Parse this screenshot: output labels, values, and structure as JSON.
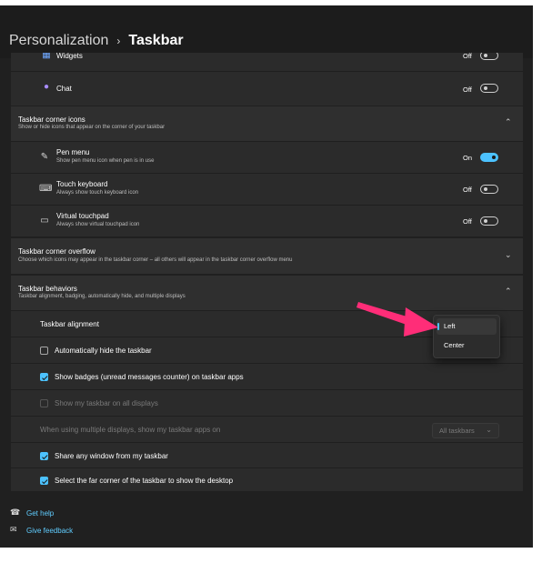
{
  "breadcrumb": {
    "parent": "Personalization",
    "separator": "›",
    "current": "Taskbar"
  },
  "top_items": [
    {
      "label": "Widgets",
      "state": "Off",
      "icon": "widgets-icon"
    },
    {
      "label": "Chat",
      "state": "Off",
      "icon": "chat-icon"
    }
  ],
  "corner_icons": {
    "title": "Taskbar corner icons",
    "subtitle": "Show or hide icons that appear on the corner of your taskbar",
    "items": [
      {
        "label": "Pen menu",
        "desc": "Show pen menu icon when pen is in use",
        "state": "On",
        "icon": "pen-icon"
      },
      {
        "label": "Touch keyboard",
        "desc": "Always show touch keyboard icon",
        "state": "Off",
        "icon": "keyboard-icon"
      },
      {
        "label": "Virtual touchpad",
        "desc": "Always show virtual touchpad icon",
        "state": "Off",
        "icon": "touchpad-icon"
      }
    ]
  },
  "corner_overflow": {
    "title": "Taskbar corner overflow",
    "subtitle": "Choose which icons may appear in the taskbar corner – all others will appear in the taskbar corner overflow menu"
  },
  "behaviors": {
    "title": "Taskbar behaviors",
    "subtitle": "Taskbar alignment, badging, automatically hide, and multiple displays",
    "alignment_label": "Taskbar alignment",
    "alignment_options": [
      "Left",
      "Center"
    ],
    "alignment_selected": "Left",
    "auto_hide": "Automatically hide the taskbar",
    "badges": "Show badges (unread messages counter) on taskbar apps",
    "all_displays": "Show my taskbar on all displays",
    "multi_display_label": "When using multiple displays, show my taskbar apps on",
    "multi_display_value": "All taskbars",
    "share_window": "Share any window from my taskbar",
    "far_corner": "Select the far corner of the taskbar to show the desktop"
  },
  "footer": {
    "help": "Get help",
    "feedback": "Give feedback"
  },
  "colors": {
    "accent": "#4cc2ff",
    "annotation_arrow": "#ff2d78",
    "background": "#202020",
    "card": "#2b2b2b"
  }
}
